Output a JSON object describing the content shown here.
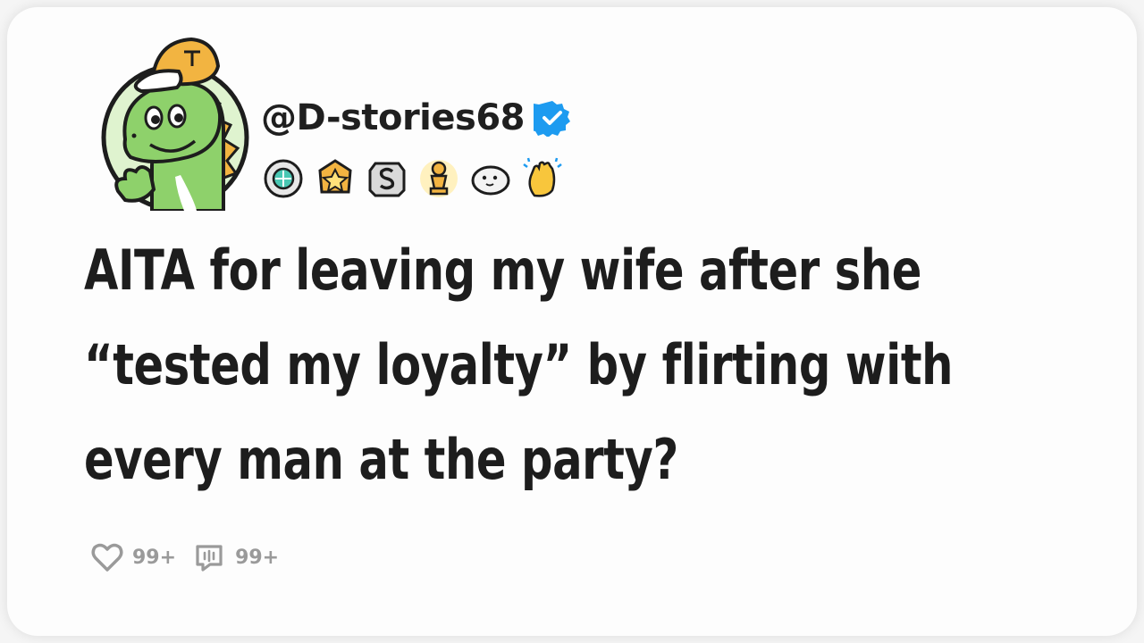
{
  "post": {
    "author": {
      "username": "@D-stories68",
      "verified": true,
      "avatar": "dinosaur-with-cap-avatar"
    },
    "badges": [
      "gem-badge",
      "star-badge",
      "s-badge",
      "trophy-badge",
      "seal-badge",
      "clap-badge"
    ],
    "title": "AITA for leaving my wife after she “tested my loyalty” by flirting with every man at the party?",
    "stats": {
      "likes": "99+",
      "comments": "99+"
    }
  },
  "colors": {
    "verified": "#1d9bf0",
    "text": "#1d1d1d",
    "muted": "#9a9a9a",
    "dino": "#8ed16b"
  }
}
